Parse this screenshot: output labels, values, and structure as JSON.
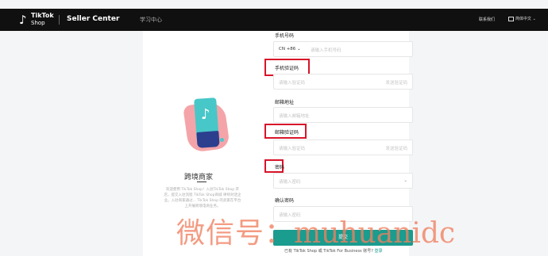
{
  "header": {
    "logo_line1": "TikTok",
    "logo_line2": "Shop",
    "seller_center": "Seller Center",
    "learning_center": "学习中心",
    "contact": "联系我们",
    "language": "简体中文 ⌄"
  },
  "brand": {
    "title": "跨境商家",
    "description": "欢迎使用 TikTok Shop！入驻TikTok Shop 开店，提交入驻流程 TikTok Shop商城 律师对话企业。入驻商家通过... TikTok Shop 的卖家在平台上开展跨境电商业务。"
  },
  "form": {
    "phone_label": "手机号码",
    "country_code": "CN +86 ⌄",
    "phone_placeholder": "请输入手机号码",
    "phone_code_label": "手机验证码",
    "phone_code_placeholder": "请输入验证码",
    "phone_code_send": "发送验证码",
    "email_label": "邮箱地址",
    "email_placeholder": "请输入邮箱地址",
    "email_code_label": "邮箱验证码",
    "email_code_placeholder": "请输入验证码",
    "email_code_send": "发送验证码",
    "password_label": "密码",
    "password_placeholder": "请输入密码",
    "confirm_label": "确认密码",
    "confirm_placeholder": "请输入密码",
    "submit": "提交",
    "footer_text": "已有 TikTok Shop 或 TikTok For Business 账号?",
    "footer_link": "登录"
  },
  "watermark": {
    "cn": "微信号：",
    "latin": "muhuanidc"
  },
  "colors": {
    "topbar": "#101010",
    "highlight": "#d8142a",
    "submit": "#1a9c8e",
    "watermark": "#f08060"
  }
}
